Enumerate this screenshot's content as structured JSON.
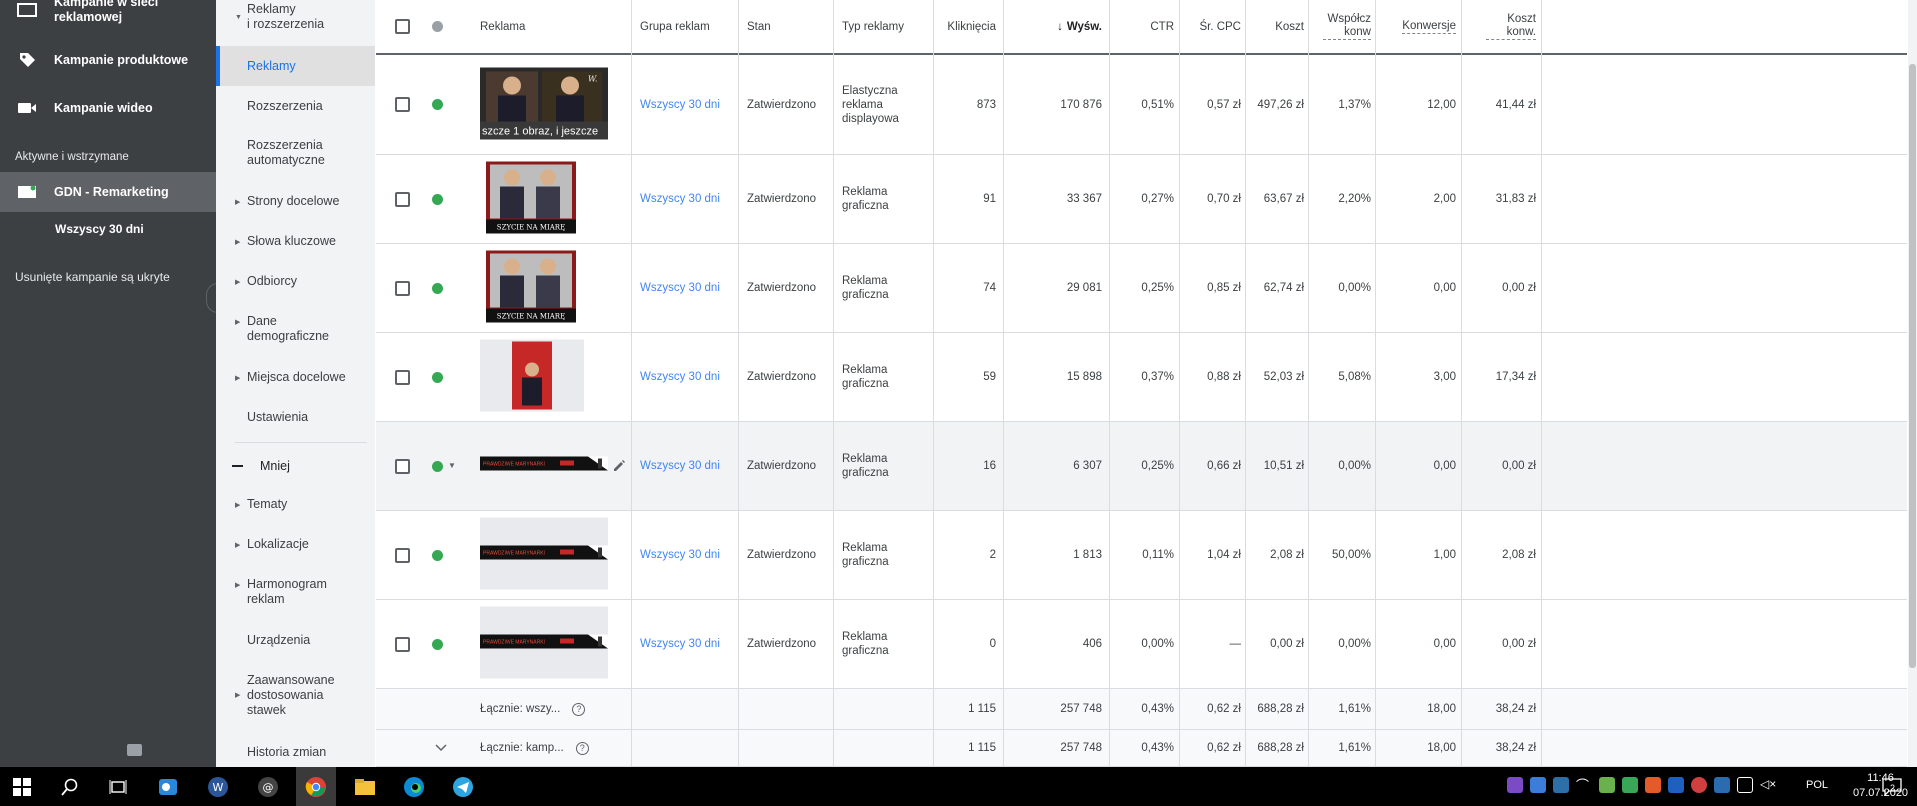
{
  "leftnav": {
    "top_item": "Kampanie w sieci reklamowej",
    "items": [
      {
        "label": "Kampanie produktowe",
        "icon": "tag-icon"
      },
      {
        "label": "Kampanie wideo",
        "icon": "video-camera-icon"
      }
    ],
    "section_label": "Aktywne i wstrzymane",
    "active_campaign": "GDN - Remarketing",
    "active_sub": "Wszyscy 30 dni",
    "hidden_note": "Usunięte kampanie są ukryte"
  },
  "secnav": {
    "items": [
      {
        "label": "Reklamy\ni rozszerzenia",
        "expandable": true
      },
      {
        "label": "Reklamy",
        "selected": true
      },
      {
        "label": "Rozszerzenia"
      },
      {
        "label": "Rozszerzenia automatyczne"
      },
      {
        "label": "Strony docelowe",
        "expandable": true
      },
      {
        "label": "Słowa kluczowe",
        "expandable": true
      },
      {
        "label": "Odbiorcy",
        "expandable": true
      },
      {
        "label": "Dane demograficzne",
        "expandable": true
      },
      {
        "label": "Miejsca docelowe",
        "expandable": true
      },
      {
        "label": "Ustawienia"
      }
    ],
    "less_label": "Mniej",
    "more_items": [
      {
        "label": "Tematy",
        "expandable": true
      },
      {
        "label": "Lokalizacje",
        "expandable": true
      },
      {
        "label": "Harmonogram reklam",
        "expandable": true
      },
      {
        "label": "Urządzenia"
      },
      {
        "label": "Zaawansowane dostosowania stawek",
        "expandable": true
      },
      {
        "label": "Historia zmian"
      }
    ]
  },
  "table": {
    "headers": {
      "ad": "Reklama",
      "group": "Grupa reklam",
      "status": "Stan",
      "type": "Typ reklamy",
      "clicks": "Kliknięcia",
      "impr": "Wyśw.",
      "ctr": "CTR",
      "cpc": "Śr. CPC",
      "cost": "Koszt",
      "convrate": "Współcz konw",
      "conv": "Konwersje",
      "costconv": "Koszt konw."
    },
    "first_ad_overlay": "szcze 1 obraz, i jeszcze",
    "banner_text": "PRAWDZIWE MARYNARKI",
    "poster_text": "SZYCIE NA MIARĘ",
    "rows": [
      {
        "group": "Wszyscy 30 dni",
        "status": "Zatwierdzono",
        "type": "Elastyczna reklama displayowa",
        "clicks": "873",
        "impr": "170 876",
        "ctr": "0,51%",
        "cpc": "0,57 zł",
        "cost": "497,26 zł",
        "convrate": "1,37%",
        "conv": "12,00",
        "costconv": "41,44 zł"
      },
      {
        "group": "Wszyscy 30 dni",
        "status": "Zatwierdzono",
        "type": "Reklama graficzna",
        "clicks": "91",
        "impr": "33 367",
        "ctr": "0,27%",
        "cpc": "0,70 zł",
        "cost": "63,67 zł",
        "convrate": "2,20%",
        "conv": "2,00",
        "costconv": "31,83 zł"
      },
      {
        "group": "Wszyscy 30 dni",
        "status": "Zatwierdzono",
        "type": "Reklama graficzna",
        "clicks": "74",
        "impr": "29 081",
        "ctr": "0,25%",
        "cpc": "0,85 zł",
        "cost": "62,74 zł",
        "convrate": "0,00%",
        "conv": "0,00",
        "costconv": "0,00 zł"
      },
      {
        "group": "Wszyscy 30 dni",
        "status": "Zatwierdzono",
        "type": "Reklama graficzna",
        "clicks": "59",
        "impr": "15 898",
        "ctr": "0,37%",
        "cpc": "0,88 zł",
        "cost": "52,03 zł",
        "convrate": "5,08%",
        "conv": "3,00",
        "costconv": "17,34 zł"
      },
      {
        "group": "Wszyscy 30 dni",
        "status": "Zatwierdzono",
        "type": "Reklama graficzna",
        "clicks": "16",
        "impr": "6 307",
        "ctr": "0,25%",
        "cpc": "0,66 zł",
        "cost": "10,51 zł",
        "convrate": "0,00%",
        "conv": "0,00",
        "costconv": "0,00 zł"
      },
      {
        "group": "Wszyscy 30 dni",
        "status": "Zatwierdzono",
        "type": "Reklama graficzna",
        "clicks": "2",
        "impr": "1 813",
        "ctr": "0,11%",
        "cpc": "1,04 zł",
        "cost": "2,08 zł",
        "convrate": "50,00%",
        "conv": "1,00",
        "costconv": "2,08 zł"
      },
      {
        "group": "Wszyscy 30 dni",
        "status": "Zatwierdzono",
        "type": "Reklama graficzna",
        "clicks": "0",
        "impr": "406",
        "ctr": "0,00%",
        "cpc": "—",
        "cost": "0,00 zł",
        "convrate": "0,00%",
        "conv": "0,00",
        "costconv": "0,00 zł"
      }
    ],
    "totals": [
      {
        "label": "Łącznie: wszy...",
        "clicks": "1 115",
        "impr": "257 748",
        "ctr": "0,43%",
        "cpc": "0,62 zł",
        "cost": "688,28 zł",
        "convrate": "1,61%",
        "conv": "18,00",
        "costconv": "38,24 zł"
      },
      {
        "label": "Łącznie: kamp...",
        "clicks": "1 115",
        "impr": "257 748",
        "ctr": "0,43%",
        "cpc": "0,62 zł",
        "cost": "688,28 zł",
        "convrate": "1,61%",
        "conv": "18,00",
        "costconv": "38,24 zł"
      }
    ]
  },
  "taskbar": {
    "language": "POL",
    "time": "11:46",
    "date": "07.07.2020",
    "notifications": "2"
  }
}
